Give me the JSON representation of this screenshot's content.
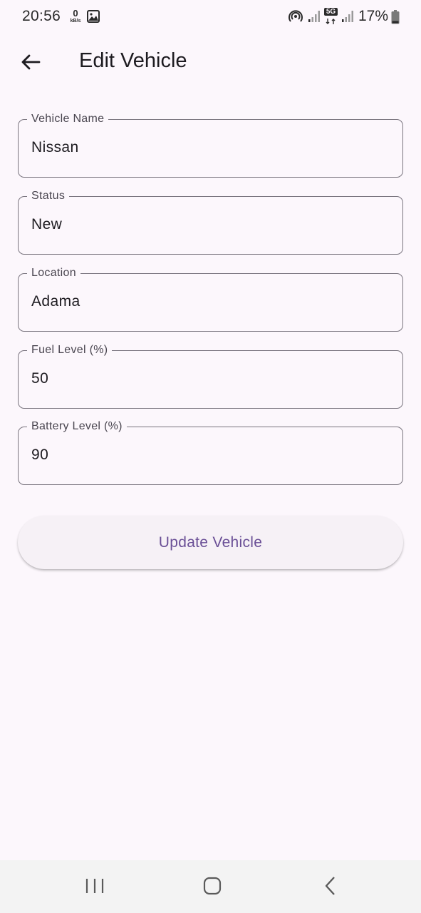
{
  "status_bar": {
    "time": "20:56",
    "net_speed_value": "0",
    "net_speed_unit": "kB/s",
    "network_type": "5G",
    "battery_percent": "17%",
    "icons": [
      "gallery-icon",
      "hotspot-icon",
      "signal-icon",
      "5g-icon",
      "signal-icon",
      "battery-icon"
    ]
  },
  "app_bar": {
    "back_icon": "arrow-left-icon",
    "title": "Edit Vehicle"
  },
  "form": {
    "fields": [
      {
        "label": "Vehicle Name",
        "value": "Nissan"
      },
      {
        "label": "Status",
        "value": "New"
      },
      {
        "label": "Location",
        "value": "Adama"
      },
      {
        "label": "Fuel Level (%)",
        "value": "50"
      },
      {
        "label": "Battery Level (%)",
        "value": "90"
      }
    ],
    "submit_label": "Update Vehicle"
  },
  "nav_bar": {
    "icons": [
      "recent-apps-icon",
      "home-icon",
      "back-icon"
    ]
  },
  "colors": {
    "background": "#fcf7fc",
    "accent": "#6a4f96",
    "outline": "#79747e",
    "button_surface": "#f6f1f6"
  }
}
